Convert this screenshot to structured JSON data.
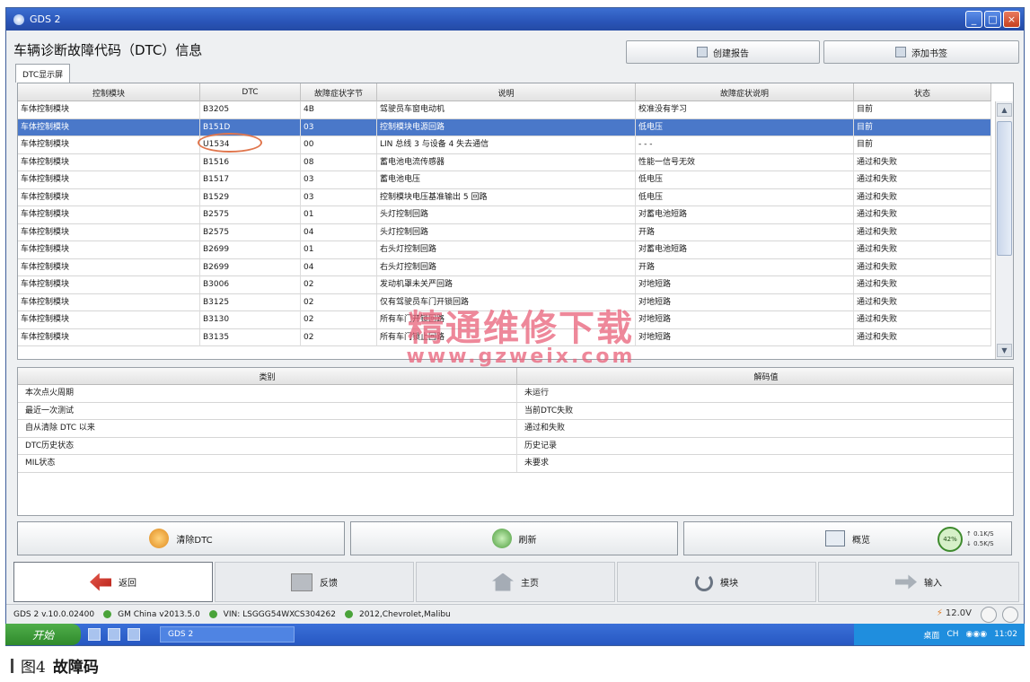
{
  "window": {
    "title": "GDS 2",
    "controls": {
      "minimize": "_",
      "maximize": "□",
      "close": "×"
    }
  },
  "header": {
    "page_title": "车辆诊断故障代码（DTC）信息",
    "report_button": "创建报告",
    "bookmark_button": "添加书签"
  },
  "tab": {
    "label": "DTC显示屏"
  },
  "dtc_table": {
    "columns": [
      "控制模块",
      "DTC",
      "故障症状字节",
      "说明",
      "故障症状说明",
      "状态"
    ],
    "rows": [
      [
        "车体控制模块",
        "B3205",
        "4B",
        "驾驶员车窗电动机",
        "校准没有学习",
        "目前"
      ],
      [
        "车体控制模块",
        "B151D",
        "03",
        "控制模块电源回路",
        "低电压",
        "目前"
      ],
      [
        "车体控制模块",
        "U1534",
        "00",
        "LIN 总线 3 与设备 4 失去通信",
        "- - -",
        "目前"
      ],
      [
        "车体控制模块",
        "B1516",
        "08",
        "蓄电池电流传感器",
        "性能一信号无效",
        "通过和失败"
      ],
      [
        "车体控制模块",
        "B1517",
        "03",
        "蓄电池电压",
        "低电压",
        "通过和失败"
      ],
      [
        "车体控制模块",
        "B1529",
        "03",
        "控制模块电压基准输出 5 回路",
        "低电压",
        "通过和失败"
      ],
      [
        "车体控制模块",
        "B2575",
        "01",
        "头灯控制回路",
        "对蓄电池短路",
        "通过和失败"
      ],
      [
        "车体控制模块",
        "B2575",
        "04",
        "头灯控制回路",
        "开路",
        "通过和失败"
      ],
      [
        "车体控制模块",
        "B2699",
        "01",
        "右头灯控制回路",
        "对蓄电池短路",
        "通过和失败"
      ],
      [
        "车体控制模块",
        "B2699",
        "04",
        "右头灯控制回路",
        "开路",
        "通过和失败"
      ],
      [
        "车体控制模块",
        "B3006",
        "02",
        "发动机罩未关严回路",
        "对地短路",
        "通过和失败"
      ],
      [
        "车体控制模块",
        "B3125",
        "02",
        "仅有驾驶员车门开锁回路",
        "对地短路",
        "通过和失败"
      ],
      [
        "车体控制模块",
        "B3130",
        "02",
        "所有车门开锁回路",
        "对地短路",
        "通过和失败"
      ],
      [
        "车体控制模块",
        "B3135",
        "02",
        "所有车门锁止回路",
        "对地短路",
        "通过和失败"
      ]
    ],
    "selected_row": 1
  },
  "watermark": {
    "main": "精通维修下载",
    "url": "www.gzweix.com"
  },
  "freeze_table": {
    "columns": [
      "类别",
      "解码值"
    ],
    "rows": [
      [
        "本次点火周期",
        "未运行"
      ],
      [
        "最近一次测试",
        "当前DTC失败"
      ],
      [
        "自从清除 DTC 以来",
        "通过和失败"
      ],
      [
        "DTC历史状态",
        "历史记录"
      ],
      [
        "MIL状态",
        "未要求"
      ]
    ]
  },
  "actions": {
    "clear": "清除DTC",
    "refresh": "刷新",
    "preview": "概览",
    "net_percent": "42%",
    "upload": "0.1K/S",
    "download": "0.5K/S"
  },
  "nav": {
    "back": "返回",
    "feedback": "反馈",
    "home": "主页",
    "module": "模块",
    "input": "输入"
  },
  "status_bar": {
    "version": "GDS 2 v.10.0.02400",
    "data": "GM China v2013.5.0",
    "vin": "VIN: LSGGG54WXCS304262",
    "vehicle": "2012,Chevrolet,Malibu",
    "voltage": "12.0V"
  },
  "taskbar": {
    "start": "开始",
    "task": "GDS 2",
    "tray_text": "桌面",
    "lang": "CH",
    "clock": "11:02"
  },
  "caption": {
    "figure": "图4",
    "text": "故障码"
  }
}
